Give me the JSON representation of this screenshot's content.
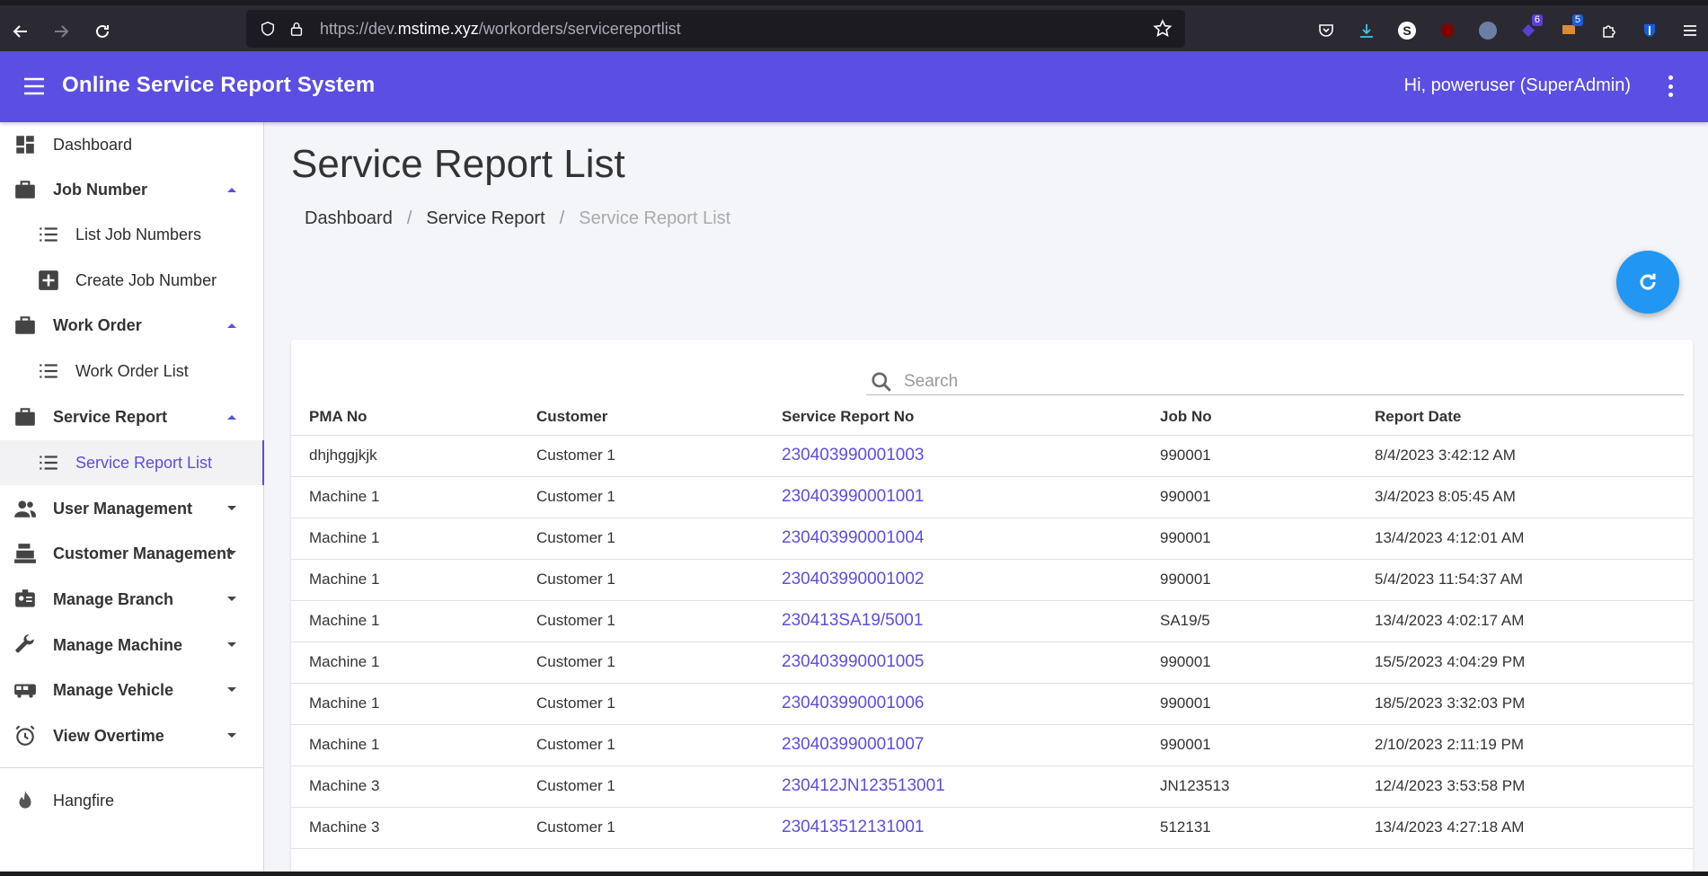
{
  "browser": {
    "url_prefix": "https://dev.",
    "url_host": "mstime.xyz",
    "url_path": "/workorders/servicereportlist",
    "ext_badge_1": "6",
    "ext_badge_2": "5"
  },
  "header": {
    "title": "Online Service Report System",
    "user_greeting": "Hi, poweruser (SuperAdmin)"
  },
  "sidebar": {
    "items": [
      {
        "label": "Dashboard"
      },
      {
        "label": "Job Number"
      },
      {
        "label": "List Job Numbers"
      },
      {
        "label": "Create Job Number"
      },
      {
        "label": "Work Order"
      },
      {
        "label": "Work Order List"
      },
      {
        "label": "Service Report"
      },
      {
        "label": "Service Report List"
      },
      {
        "label": "User Management"
      },
      {
        "label": "Customer Management"
      },
      {
        "label": "Manage Branch"
      },
      {
        "label": "Manage Machine"
      },
      {
        "label": "Manage Vehicle"
      },
      {
        "label": "View Overtime"
      },
      {
        "label": "Hangfire"
      }
    ]
  },
  "main": {
    "page_title": "Service Report List",
    "breadcrumb": [
      "Dashboard",
      "Service Report",
      "Service Report List"
    ],
    "search_placeholder": "Search",
    "columns": [
      "PMA No",
      "Customer",
      "Service Report No",
      "Job No",
      "Report Date"
    ],
    "rows": [
      [
        "dhjhggjkjk",
        "Customer 1",
        "230403990001003",
        "990001",
        "8/4/2023 3:42:12 AM"
      ],
      [
        "Machine 1",
        "Customer 1",
        "230403990001001",
        "990001",
        "3/4/2023 8:05:45 AM"
      ],
      [
        "Machine 1",
        "Customer 1",
        "230403990001004",
        "990001",
        "13/4/2023 4:12:01 AM"
      ],
      [
        "Machine 1",
        "Customer 1",
        "230403990001002",
        "990001",
        "5/4/2023 11:54:37 AM"
      ],
      [
        "Machine 1",
        "Customer 1",
        "230413SA19/5001",
        "SA19/5",
        "13/4/2023 4:02:17 AM"
      ],
      [
        "Machine 1",
        "Customer 1",
        "230403990001005",
        "990001",
        "15/5/2023 4:04:29 PM"
      ],
      [
        "Machine 1",
        "Customer 1",
        "230403990001006",
        "990001",
        "18/5/2023 3:32:03 PM"
      ],
      [
        "Machine 1",
        "Customer 1",
        "230403990001007",
        "990001",
        "2/10/2023 2:11:19 PM"
      ],
      [
        "Machine 3",
        "Customer 1",
        "230412JN123513001",
        "JN123513",
        "12/4/2023 3:53:58 PM"
      ],
      [
        "Machine 3",
        "Customer 1",
        "230413512131001",
        "512131",
        "13/4/2023 4:27:18 AM"
      ]
    ]
  },
  "colors": {
    "primary": "#5b4ee2",
    "fab": "#2196f3",
    "browser_chrome": "#2b2a33"
  }
}
